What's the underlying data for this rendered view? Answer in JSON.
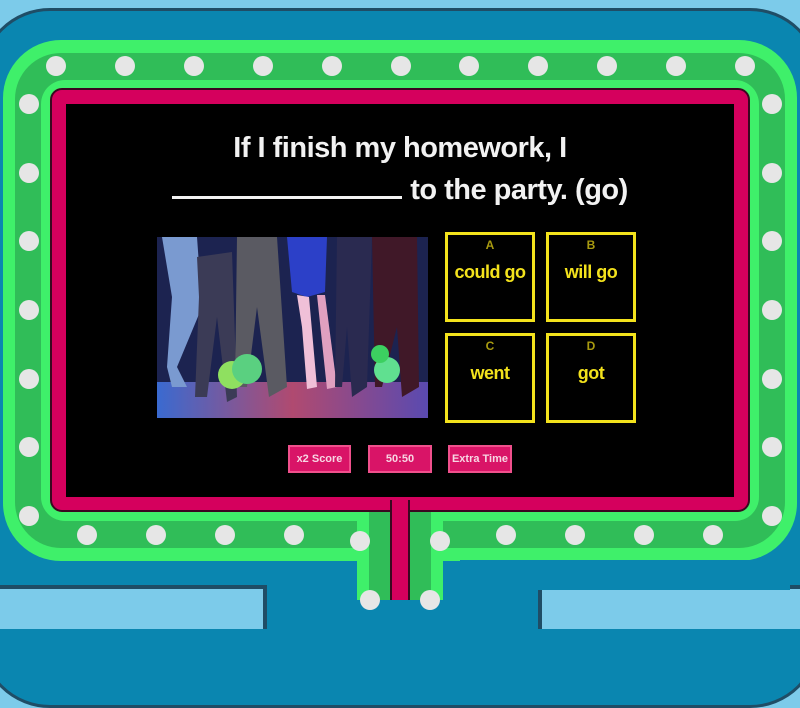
{
  "question": {
    "line1": "If I finish my homework, I",
    "line2": "to the party. (go)"
  },
  "image": {
    "description": "dancing-party-photo"
  },
  "answers": [
    {
      "letter": "A",
      "text": "could go"
    },
    {
      "letter": "B",
      "text": "will go"
    },
    {
      "letter": "C",
      "text": "went"
    },
    {
      "letter": "D",
      "text": "got"
    }
  ],
  "powerups": [
    {
      "label": "x2 Score"
    },
    {
      "label": "50:50"
    },
    {
      "label": "Extra Time"
    }
  ],
  "colors": {
    "frame_pink": "#d5005d",
    "ring_light_green": "#3ff06a",
    "ring_dark_green": "#30bd58",
    "outer_blue": "#0a86b0",
    "answer_yellow": "#f3e21c",
    "powerup_pink": "#d91467",
    "bulb": "#e6e6e6"
  }
}
